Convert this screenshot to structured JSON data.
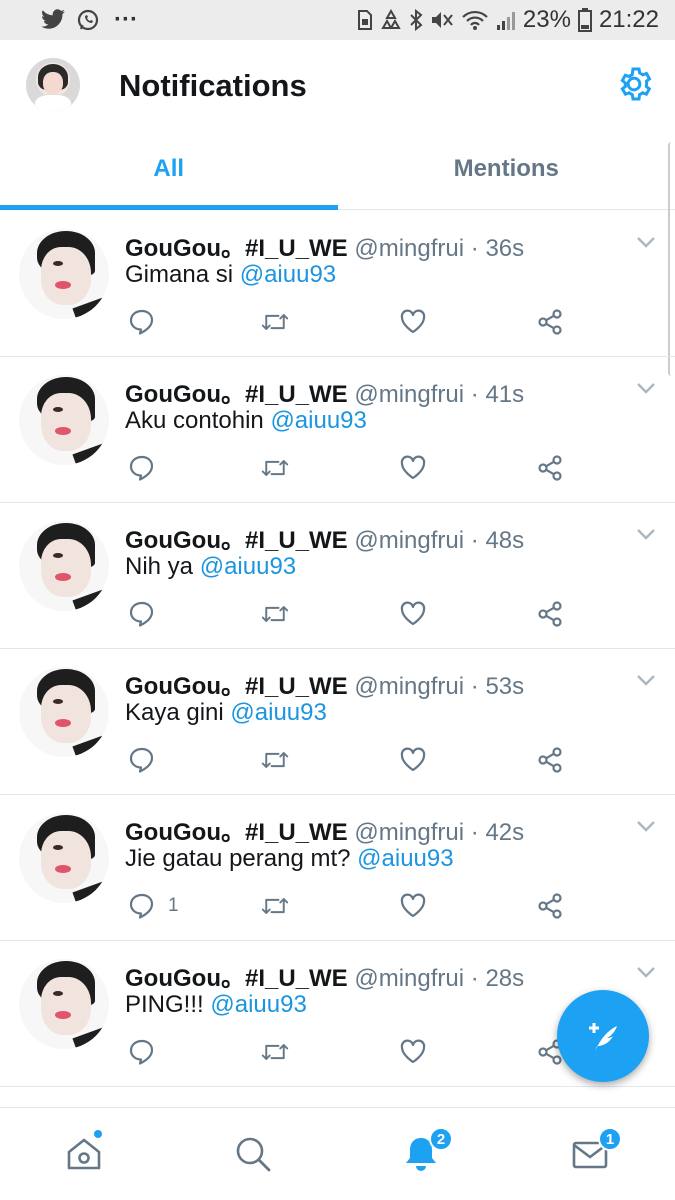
{
  "status_bar": {
    "left_icons": [
      "twitter-bird-icon",
      "whatsapp-icon",
      "more-dots-icon"
    ],
    "more_label": "···",
    "right_icons": [
      "sim-icon",
      "recycle-icon",
      "bluetooth-icon",
      "mute-icon",
      "wifi-icon",
      "signal-icon",
      "battery-icon"
    ],
    "battery": "23%",
    "time": "21:22"
  },
  "header": {
    "title": "Notifications",
    "settings_icon": "gear-icon"
  },
  "tabs": [
    {
      "label": "All",
      "active": true
    },
    {
      "label": "Mentions",
      "active": false
    }
  ],
  "tweets": [
    {
      "name": "GouGou。#I_U_WE",
      "handle": "@mingfrui",
      "separator": "·",
      "time": "36s",
      "text": "Gimana si ",
      "mention": "@aiuu93",
      "reply_count": ""
    },
    {
      "name": "GouGou。#I_U_WE",
      "handle": "@mingfrui",
      "separator": "·",
      "time": "41s",
      "text": "Aku contohin ",
      "mention": "@aiuu93",
      "reply_count": ""
    },
    {
      "name": "GouGou。#I_U_WE",
      "handle": "@mingfrui",
      "separator": "·",
      "time": "48s",
      "text": "Nih ya ",
      "mention": "@aiuu93",
      "reply_count": ""
    },
    {
      "name": "GouGou。#I_U_WE",
      "handle": "@mingfrui",
      "separator": "·",
      "time": "53s",
      "text": "Kaya gini ",
      "mention": "@aiuu93",
      "reply_count": ""
    },
    {
      "name": "GouGou。#I_U_WE",
      "handle": "@mingfrui",
      "separator": "·",
      "time": "42s",
      "text": "Jie gatau perang mt? ",
      "mention": "@aiuu93",
      "reply_count": "1"
    },
    {
      "name": "GouGou。#I_U_WE",
      "handle": "@mingfrui",
      "separator": "·",
      "time": "28s",
      "text": "PING!!! ",
      "mention": "@aiuu93",
      "reply_count": ""
    }
  ],
  "fab": {
    "icon": "compose-tweet-icon"
  },
  "bottom_nav": {
    "items": [
      {
        "icon": "home-icon",
        "indicator": "dot"
      },
      {
        "icon": "search-icon"
      },
      {
        "icon": "notifications-bell-icon",
        "badge": "2"
      },
      {
        "icon": "messages-envelope-icon",
        "badge": "1"
      }
    ]
  },
  "colors": {
    "accent": "#1da1f2",
    "mention": "#1b95e0",
    "secondary_text": "#657786",
    "primary_text": "#14171a",
    "divider": "#e1e8ed",
    "status_bar_bg": "#ececec"
  }
}
